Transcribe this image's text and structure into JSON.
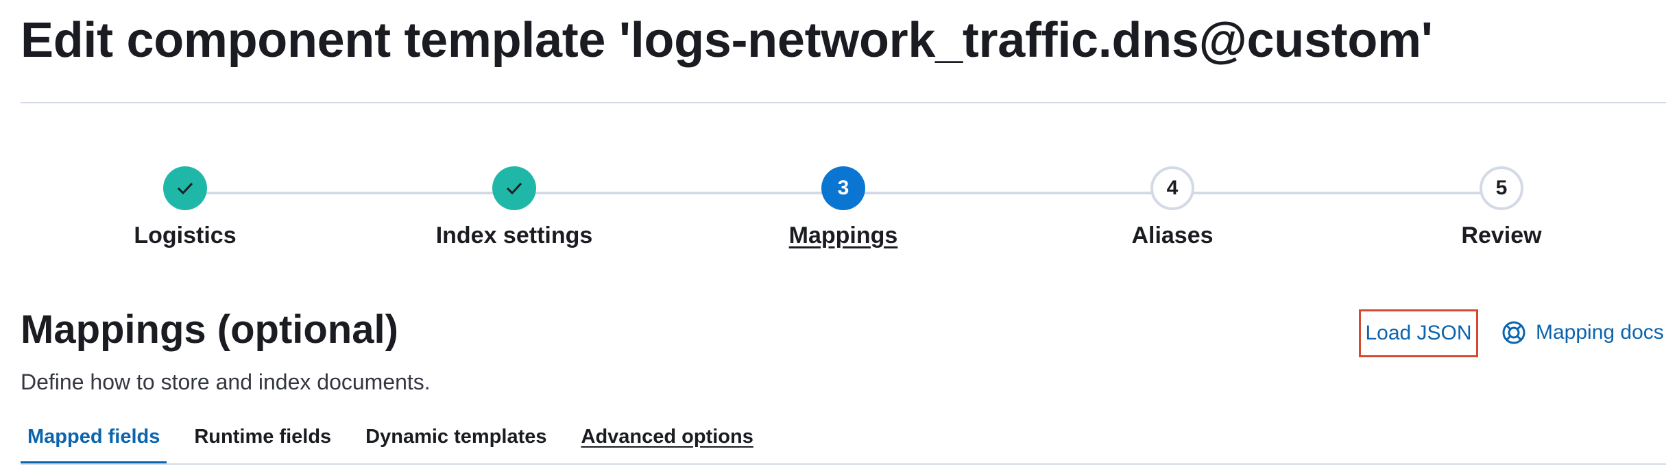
{
  "header": {
    "title": "Edit component template 'logs-network_traffic.dns@custom'"
  },
  "stepper": {
    "steps": [
      {
        "number": "1",
        "label": "Logistics",
        "status": "complete",
        "icon": "check-icon"
      },
      {
        "number": "2",
        "label": "Index settings",
        "status": "complete",
        "icon": "check-icon"
      },
      {
        "number": "3",
        "label": "Mappings",
        "status": "current"
      },
      {
        "number": "4",
        "label": "Aliases",
        "status": "incomplete"
      },
      {
        "number": "5",
        "label": "Review",
        "status": "incomplete"
      }
    ]
  },
  "section": {
    "title": "Mappings (optional)",
    "description": "Define how to store and index documents.",
    "load_json_label": "Load JSON",
    "mapping_docs_label": "Mapping docs",
    "mapping_docs_icon": "help-lifebuoy-icon"
  },
  "tabs": [
    {
      "label": "Mapped fields",
      "selected": true
    },
    {
      "label": "Runtime fields",
      "selected": false
    },
    {
      "label": "Dynamic templates",
      "selected": false
    },
    {
      "label": "Advanced options",
      "selected": false
    }
  ],
  "colors": {
    "complete": "#1fb8a8",
    "current": "#0b76d2",
    "link": "#0b64ad",
    "highlight_border": "#d44a2e"
  }
}
